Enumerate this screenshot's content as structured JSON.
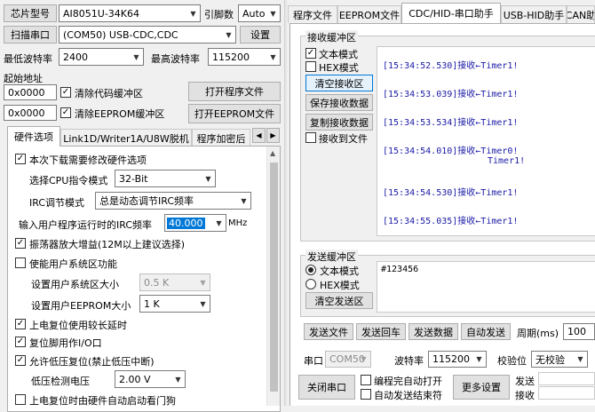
{
  "top": {
    "chip_label": "芯片型号",
    "chip_value": "AI8051U-34K64",
    "pin_label": "引脚数",
    "pin_value": "Auto",
    "scan_button": "扫描串口",
    "port_value": "(COM50) USB-CDC,CDC",
    "settings_button": "设置",
    "min_baud_label": "最低波特率",
    "min_baud_value": "2400",
    "max_baud_label": "最高波特率",
    "max_baud_value": "115200",
    "start_addr_label": "起始地址",
    "addr1": "0x0000",
    "clear_code_label": "清除代码缓冲区",
    "open_prog_button": "打开程序文件",
    "addr2": "0x0000",
    "clear_eeprom_label": "清除EEPROM缓冲区",
    "open_eeprom_button": "打开EEPROM文件"
  },
  "left_tabs": [
    "硬件选项",
    "Link1D/Writer1A/U8W脱机",
    "程序加密后"
  ],
  "hw": {
    "modify_label": "本次下载需要修改硬件选项",
    "cpu_mode_label": "选择CPU指令模式",
    "cpu_mode_value": "32-Bit",
    "irc_mode_label": "IRC调节模式",
    "irc_mode_value": "总是动态调节IRC频率",
    "irc_freq_label": "输入用户程序运行时的IRC频率",
    "irc_freq_value": "40.000",
    "irc_unit": "MHz",
    "amp_label": "振荡器放大增益(12M以上建议选择)",
    "user_sys_label": "使能用户系统区功能",
    "sys_size_label": "设置用户系统区大小",
    "sys_size_value": "0.5 K",
    "eeprom_size_label": "设置用户EEPROM大小",
    "eeprom_size_value": "1 K",
    "power_delay_label": "上电复位使用较长延时",
    "reset_io_label": "复位脚用作I/O口",
    "low_volt_label": "允许低压复位(禁止低压中断)",
    "low_volt_detect_label": "低压检测电压",
    "low_volt_value": "2.00 V",
    "watchdog_label": "上电复位时由硬件自动启动看门狗"
  },
  "right_tabs": [
    "程序文件",
    "EEPROM文件",
    "CDC/HID-串口助手",
    "USB-HID助手",
    "CAN助"
  ],
  "recv": {
    "title": "接收缓冲区",
    "text_mode": "文本模式",
    "hex_mode": "HEX模式",
    "clear_button": "清空接收区",
    "save_button": "保存接收数据",
    "copy_button": "复制接收数据",
    "to_file_label": "接收到文件",
    "lines": [
      "[15:34:52.530]接收←Timer1!",
      "[15:34:53.039]接收←Timer1!",
      "[15:34:53.534]接收←Timer1!",
      "[15:34:54.010]接收←Timer0!",
      "Timer1!",
      "[15:34:54.530]接收←Timer1!",
      "[15:34:55.035]接收←Timer1!"
    ]
  },
  "send": {
    "title": "发送缓冲区",
    "text_mode": "文本模式",
    "hex_mode": "HEX模式",
    "clear_button": "清空发送区",
    "content": "#123456",
    "send_file_button": "发送文件",
    "send_return_button": "发送回车",
    "send_data_button": "发送数据",
    "auto_send_button": "自动发送",
    "period_label": "周期(ms)",
    "period_value": "100"
  },
  "serial": {
    "port_label": "串口",
    "port_value": "COM50",
    "baud_label": "波特率",
    "baud_value": "115200",
    "parity_label": "校验位",
    "parity_value": "无校验",
    "close_button": "关闭串口",
    "auto_open_label": "编程完自动打开",
    "auto_end_label": "自动发送结束符",
    "more_button": "更多设置",
    "send_count_label": "发送",
    "recv_count_label": "接收"
  }
}
